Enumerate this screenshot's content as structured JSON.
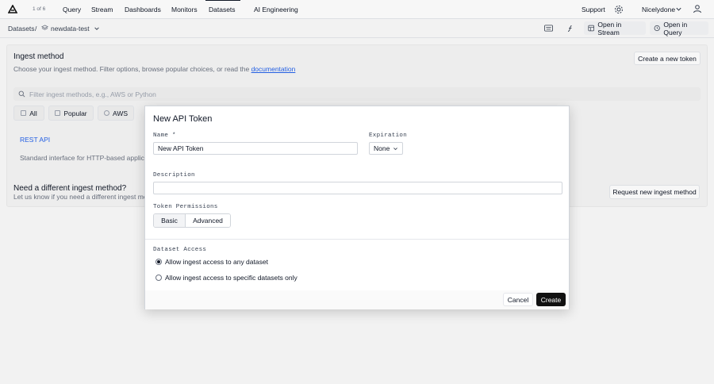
{
  "topnav": {
    "counter": "1 of 6",
    "items": [
      "Query",
      "Stream",
      "Dashboards",
      "Monitors",
      "Datasets",
      "AI Engineering"
    ],
    "active": "Datasets",
    "support": "Support",
    "org": "Nicelydone"
  },
  "breadcrumb": {
    "root": "Datasets",
    "separator": "/",
    "dataset": "newdata-test",
    "open_stream": "Open in Stream",
    "open_query": "Open in Query"
  },
  "ingest": {
    "title": "Ingest method",
    "subtitle": "Choose your ingest method. Filter options, browse popular choices, or read the",
    "doc_link": "documentation",
    "token_button": "Create a new token",
    "filter_placeholder": "Filter ingest methods, e.g., AWS or Python",
    "chips": [
      "All",
      "Popular",
      "AWS"
    ],
    "method_title": "REST API",
    "method_desc": "Standard interface for HTTP-based applica",
    "need_title": "Need a different ingest method?",
    "need_sub": "Let us know if you need a different ingest me",
    "request_button": "Request new ingest method"
  },
  "modal": {
    "title": "New API Token",
    "name_label": "Name *",
    "name_value": "New API Token",
    "expiration_label": "Expiration",
    "expiration_value": "None",
    "description_label": "Description",
    "description_value": "",
    "permissions_label": "Token Permissions",
    "tab_basic": "Basic",
    "tab_advanced": "Advanced",
    "dataset_access_label": "Dataset Access",
    "radio_any": "Allow ingest access to any dataset",
    "radio_specific": "Allow ingest access to specific datasets only",
    "selected": "any",
    "cancel": "Cancel",
    "create": "Create"
  }
}
